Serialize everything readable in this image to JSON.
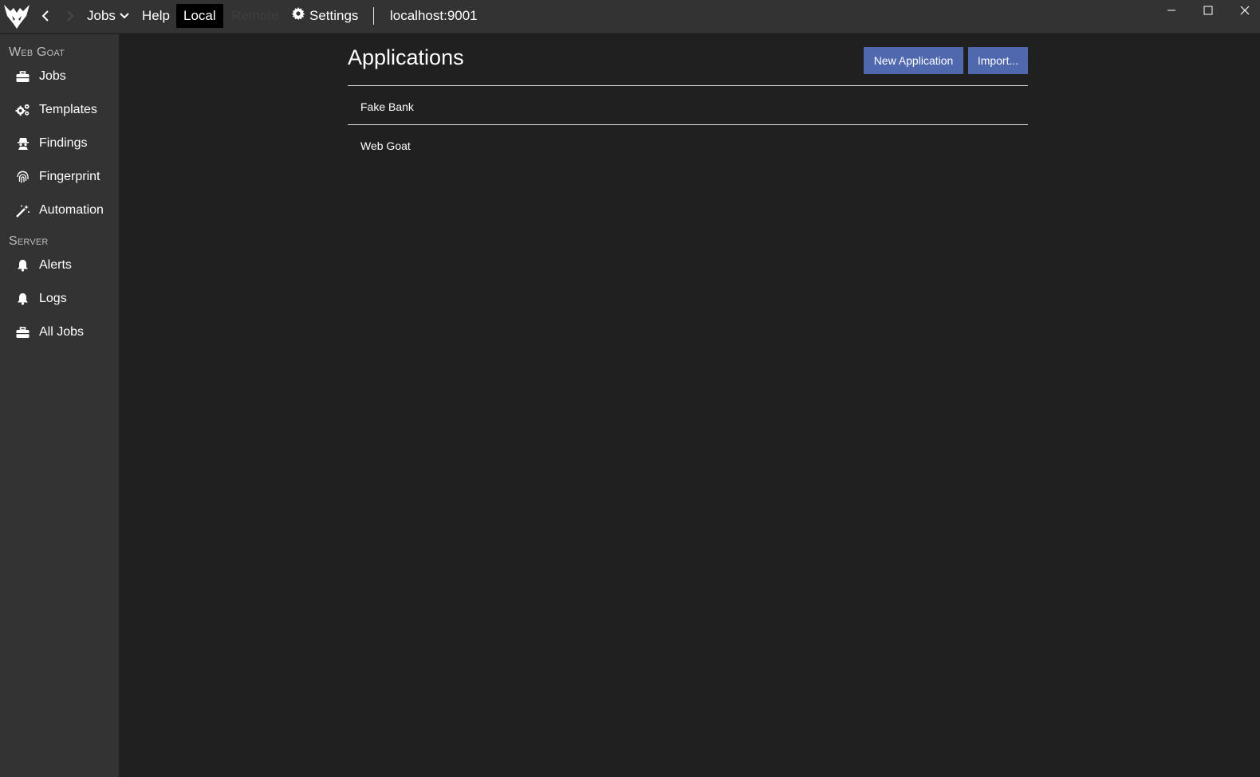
{
  "titlebar": {
    "menu": {
      "jobs": "Jobs",
      "help": "Help",
      "local": "Local",
      "remote": "Remote",
      "settings": "Settings"
    },
    "server": "localhost:9001"
  },
  "sidebar": {
    "section1": "Web Goat",
    "items1": [
      {
        "label": "Jobs",
        "icon": "briefcase-icon"
      },
      {
        "label": "Templates",
        "icon": "cogs-icon"
      },
      {
        "label": "Findings",
        "icon": "spy-icon"
      },
      {
        "label": "Fingerprint",
        "icon": "fingerprint-icon"
      },
      {
        "label": "Automation",
        "icon": "wand-icon"
      }
    ],
    "section2": "Server",
    "items2": [
      {
        "label": "Alerts",
        "icon": "bell-icon"
      },
      {
        "label": "Logs",
        "icon": "bell-icon"
      },
      {
        "label": "All Jobs",
        "icon": "briefcase-icon"
      }
    ]
  },
  "main": {
    "title": "Applications",
    "new_button": "New Application",
    "import_button": "Import...",
    "applications": [
      {
        "name": "Fake Bank"
      },
      {
        "name": "Web Goat"
      }
    ]
  },
  "colors": {
    "accent": "#5068ae",
    "titlebar": "#333333",
    "background": "#202020"
  }
}
